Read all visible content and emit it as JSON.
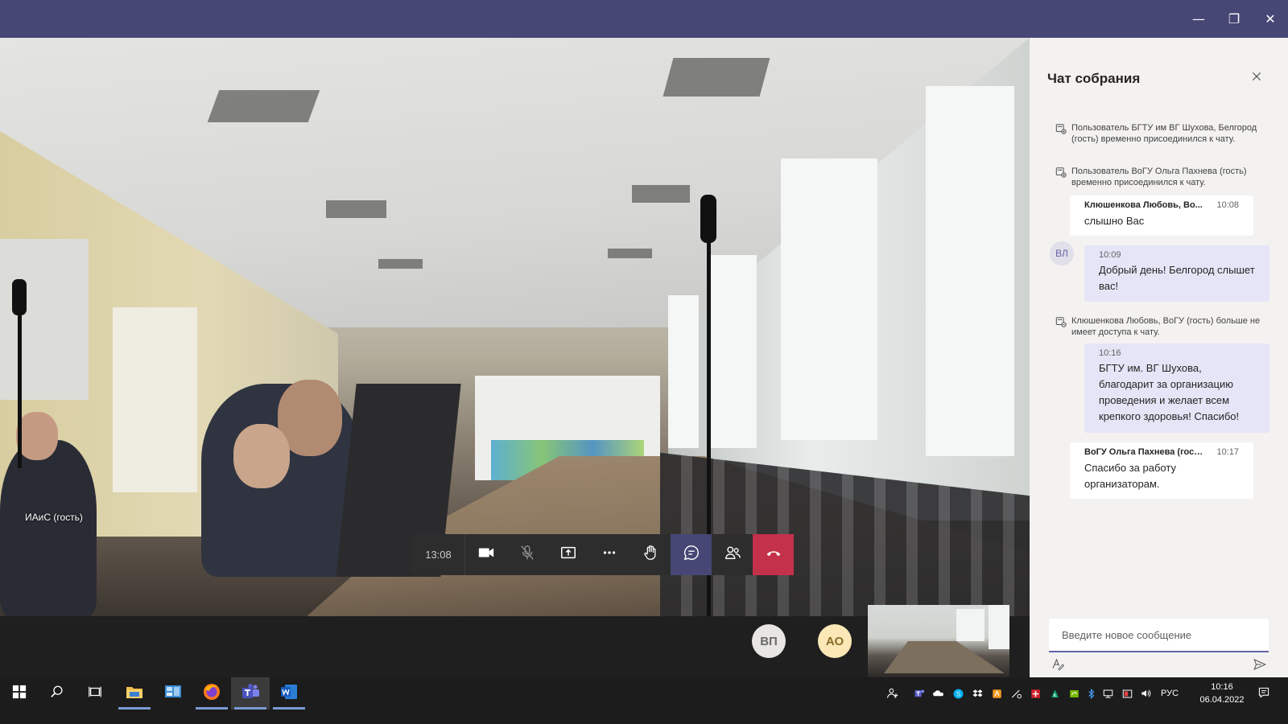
{
  "window": {
    "minimize_glyph": "—",
    "maximize_glyph": "❐",
    "close_glyph": "✕"
  },
  "video": {
    "participant_name": "ИАиС (гость)"
  },
  "controls": {
    "timer": "13:08",
    "buttons": [
      "camera-icon",
      "mic-off-icon",
      "share-screen-icon",
      "more-icon",
      "raise-hand-icon",
      "chat-icon",
      "participants-icon",
      "hang-up-icon"
    ]
  },
  "strip": {
    "avatar_1": "ВП",
    "avatar_2": "АО"
  },
  "chat": {
    "title": "Чат собрания",
    "system_1": "Пользователь БГТУ им ВГ Шухова, Белгород (гость) временно присоединился к чату.",
    "system_2": "Пользователь ВоГУ Ольга Пахнева (гость) временно присоединился к чату.",
    "msg_1": {
      "avatar": "ВЛ",
      "author": "Клюшенкова Любовь, Во...",
      "time": "10:08",
      "text": "слышно Вас"
    },
    "msg_2": {
      "time": "10:09",
      "text": "Добрый день! Белгород слышет вас!"
    },
    "system_3": "Клюшенкова Любовь, ВоГУ (гость) больше не имеет доступа к чату.",
    "msg_3": {
      "time": "10:16",
      "text": "БГТУ им. ВГ Шухова, благодарит за организацию проведения и желает всем крепкого здоровья! Спасибо!"
    },
    "msg_4": {
      "author": "ВоГУ Ольга Пахнева (гость)",
      "time": "10:17",
      "text": "Спасибо за работу организаторам."
    },
    "compose_placeholder": "Введите новое сообщение"
  },
  "taskbar": {
    "language": "РУС",
    "time": "10:16",
    "date": "06.04.2022"
  },
  "colors": {
    "titlebar": "#464775",
    "accent": "#6264a7",
    "hangup": "#c4314b",
    "outgoing_bubble": "#e5e5f7"
  }
}
